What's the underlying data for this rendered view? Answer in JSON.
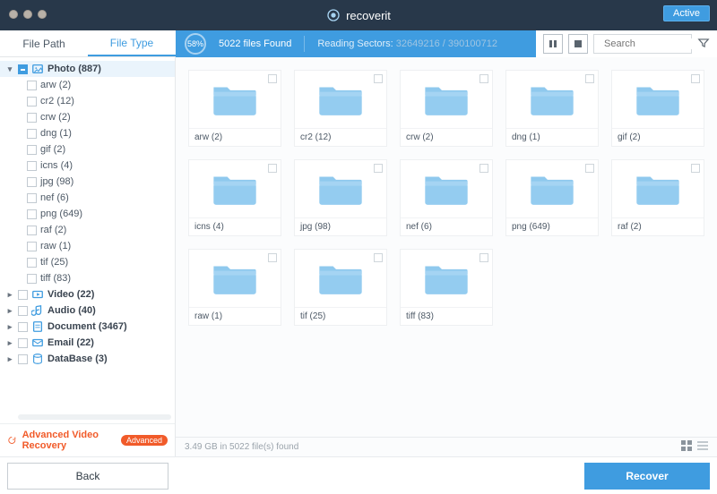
{
  "brand": "recoverit",
  "active_button": "Active",
  "tabs": {
    "path": "File Path",
    "type": "File Type"
  },
  "progress": {
    "percent": "58%",
    "files_found": "5022 files Found",
    "reading_label": "Reading Sectors:",
    "sectors": "32649216 / 390100712"
  },
  "search": {
    "placeholder": "Search"
  },
  "sidebar": {
    "categories": [
      {
        "label": "Photo (887)",
        "expanded": true,
        "selected": true,
        "icon": "image",
        "children": [
          {
            "label": "arw (2)"
          },
          {
            "label": "cr2 (12)"
          },
          {
            "label": "crw (2)"
          },
          {
            "label": "dng (1)"
          },
          {
            "label": "gif (2)"
          },
          {
            "label": "icns (4)"
          },
          {
            "label": "jpg (98)"
          },
          {
            "label": "nef (6)"
          },
          {
            "label": "png (649)"
          },
          {
            "label": "raf (2)"
          },
          {
            "label": "raw (1)"
          },
          {
            "label": "tif (25)"
          },
          {
            "label": "tiff (83)"
          }
        ]
      },
      {
        "label": "Video (22)",
        "icon": "video"
      },
      {
        "label": "Audio (40)",
        "icon": "audio"
      },
      {
        "label": "Document (3467)",
        "icon": "document"
      },
      {
        "label": "Email (22)",
        "icon": "email"
      },
      {
        "label": "DataBase (3)",
        "icon": "database"
      }
    ],
    "advanced_label": "Advanced Video Recovery",
    "advanced_badge": "Advanced"
  },
  "folders": [
    {
      "label": "arw (2)"
    },
    {
      "label": "cr2 (12)"
    },
    {
      "label": "crw (2)"
    },
    {
      "label": "dng (1)"
    },
    {
      "label": "gif (2)"
    },
    {
      "label": "icns (4)"
    },
    {
      "label": "jpg (98)"
    },
    {
      "label": "nef (6)"
    },
    {
      "label": "png (649)"
    },
    {
      "label": "raf (2)"
    },
    {
      "label": "raw (1)"
    },
    {
      "label": "tif (25)"
    },
    {
      "label": "tiff (83)"
    }
  ],
  "status_line": "3.49 GB in 5022 file(s) found",
  "footer": {
    "back": "Back",
    "recover": "Recover"
  }
}
